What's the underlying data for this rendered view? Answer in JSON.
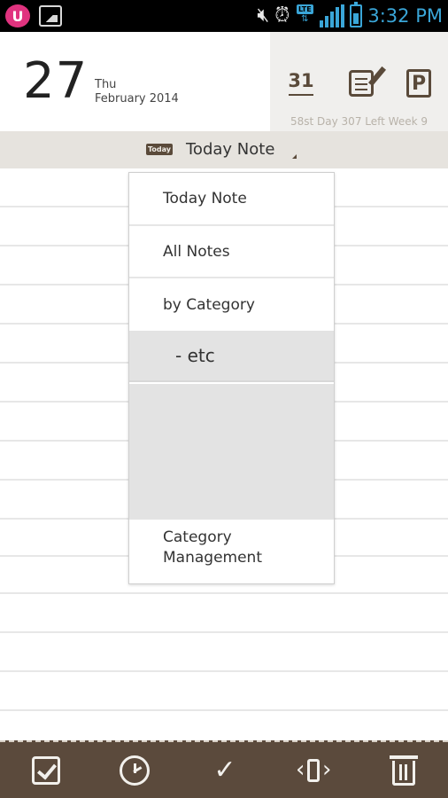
{
  "status_bar": {
    "left_icons": [
      "uplus-icon",
      "gallery-icon"
    ],
    "right_icons": [
      "volume-icon",
      "alarm-icon",
      "lte-icon",
      "signal-icon",
      "battery-icon"
    ],
    "lte_label": "LTE",
    "time": "3:32 PM",
    "accent": "#3aa6d8"
  },
  "header": {
    "day": "27",
    "weekday": "Thu",
    "month_year": "February 2014",
    "calendar_button_label": "31",
    "stats": "58st Day 307 Left Week 9"
  },
  "title_bar": {
    "badge": "Today",
    "title": "Today Note"
  },
  "dropdown": {
    "items": [
      {
        "label": "Today Note"
      },
      {
        "label": "All Notes"
      },
      {
        "label": "by Category"
      }
    ],
    "category_items": [
      "- etc"
    ],
    "footer_item": "Category Management"
  },
  "toolbar": {
    "icons": [
      "checkbox-icon",
      "clock-icon",
      "magic-check-icon",
      "phone-rotate-icon",
      "trash-icon"
    ],
    "brand": "#5b4a3c"
  }
}
